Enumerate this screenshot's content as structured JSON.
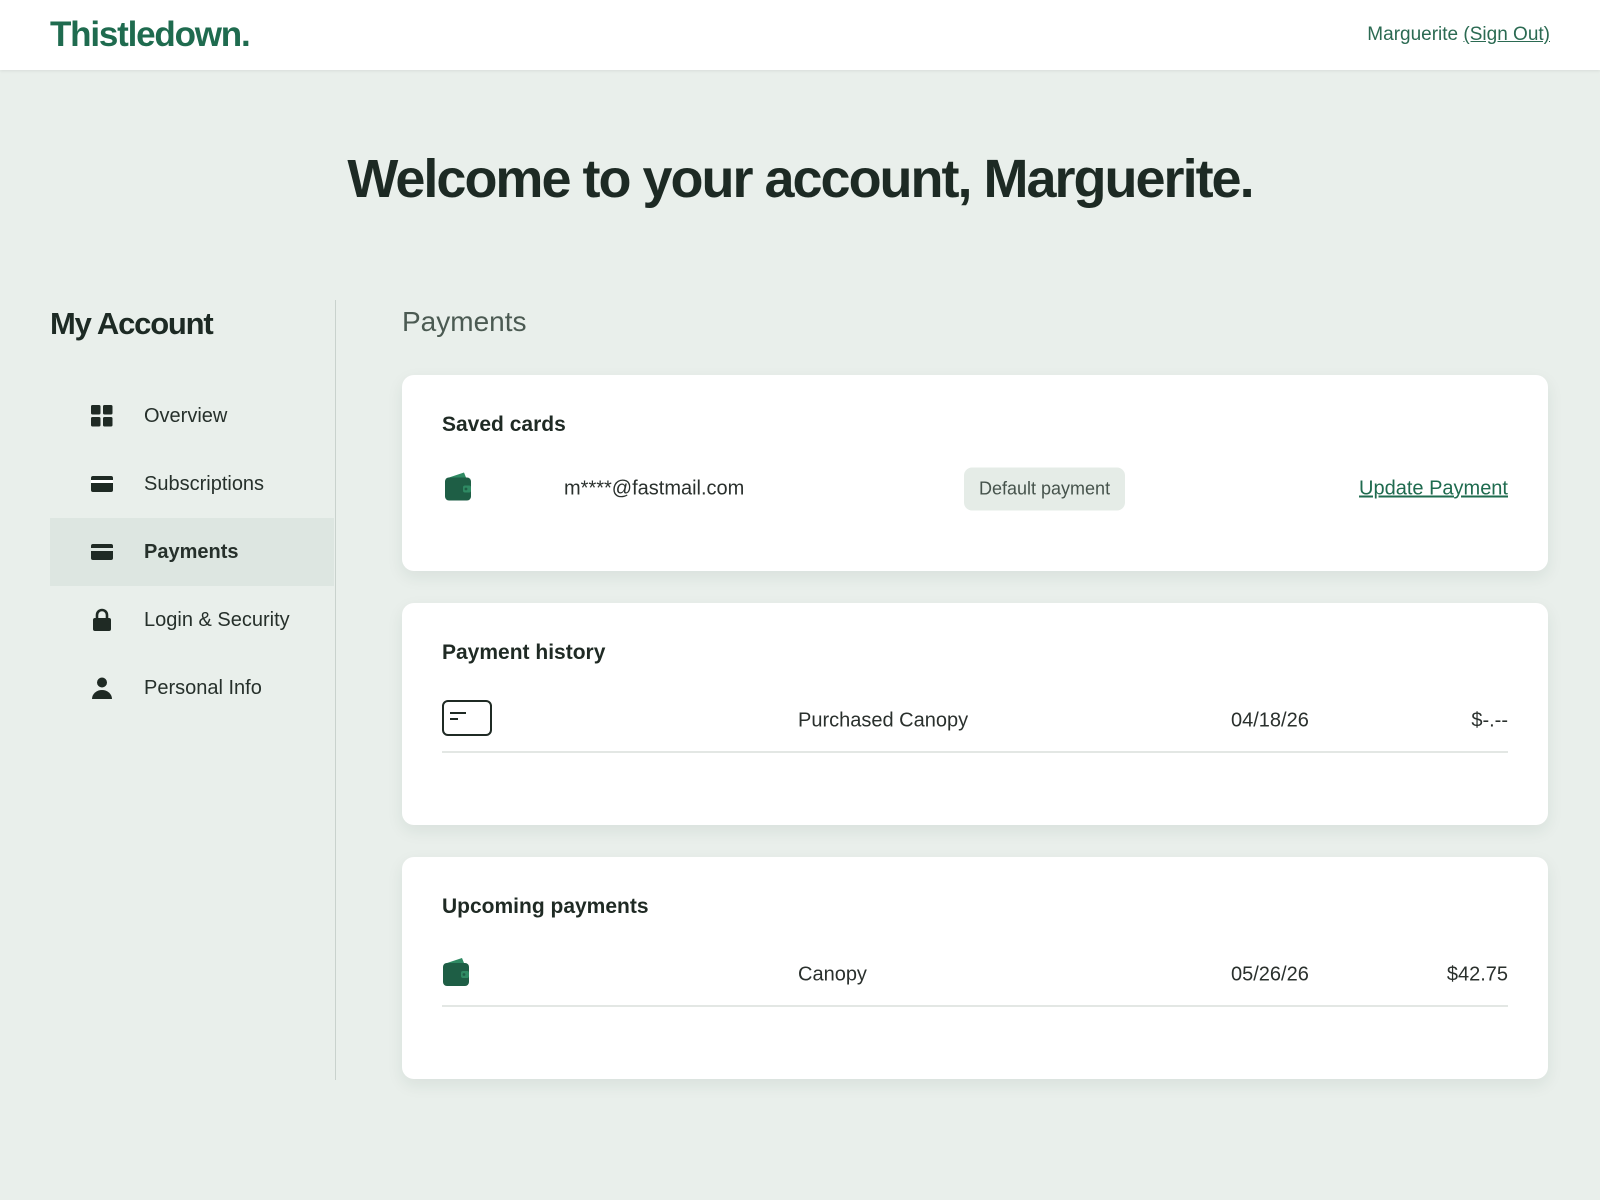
{
  "header": {
    "logo": "Thistledown.",
    "user_name": "Marguerite",
    "sign_out": "(Sign Out)"
  },
  "welcome": "Welcome to your account, Marguerite.",
  "sidebar": {
    "title": "My Account",
    "items": [
      {
        "label": "Overview",
        "icon": "grid-icon"
      },
      {
        "label": "Subscriptions",
        "icon": "card-icon"
      },
      {
        "label": "Payments",
        "icon": "card-icon",
        "active": true
      },
      {
        "label": "Login & Security",
        "icon": "lock-icon"
      },
      {
        "label": "Personal Info",
        "icon": "person-icon"
      }
    ]
  },
  "main": {
    "section_title": "Payments",
    "saved_cards": {
      "title": "Saved cards",
      "items": [
        {
          "icon": "wallet-icon",
          "email": "m****@fastmail.com",
          "badge": "Default payment",
          "action": "Update Payment"
        }
      ]
    },
    "payment_history": {
      "title": "Payment history",
      "rows": [
        {
          "icon": "credit-card-outline-icon",
          "description": "Purchased Canopy",
          "date": "04/18/26",
          "amount": "$-.--"
        }
      ]
    },
    "upcoming_payments": {
      "title": "Upcoming payments",
      "rows": [
        {
          "icon": "wallet-icon",
          "description": "Canopy",
          "date": "05/26/26",
          "amount": "$42.75"
        }
      ]
    }
  },
  "colors": {
    "brand": "#1f6b4f",
    "background": "#e9efeb",
    "active_nav": "#dde6e1",
    "badge_bg": "#e5ece7"
  }
}
